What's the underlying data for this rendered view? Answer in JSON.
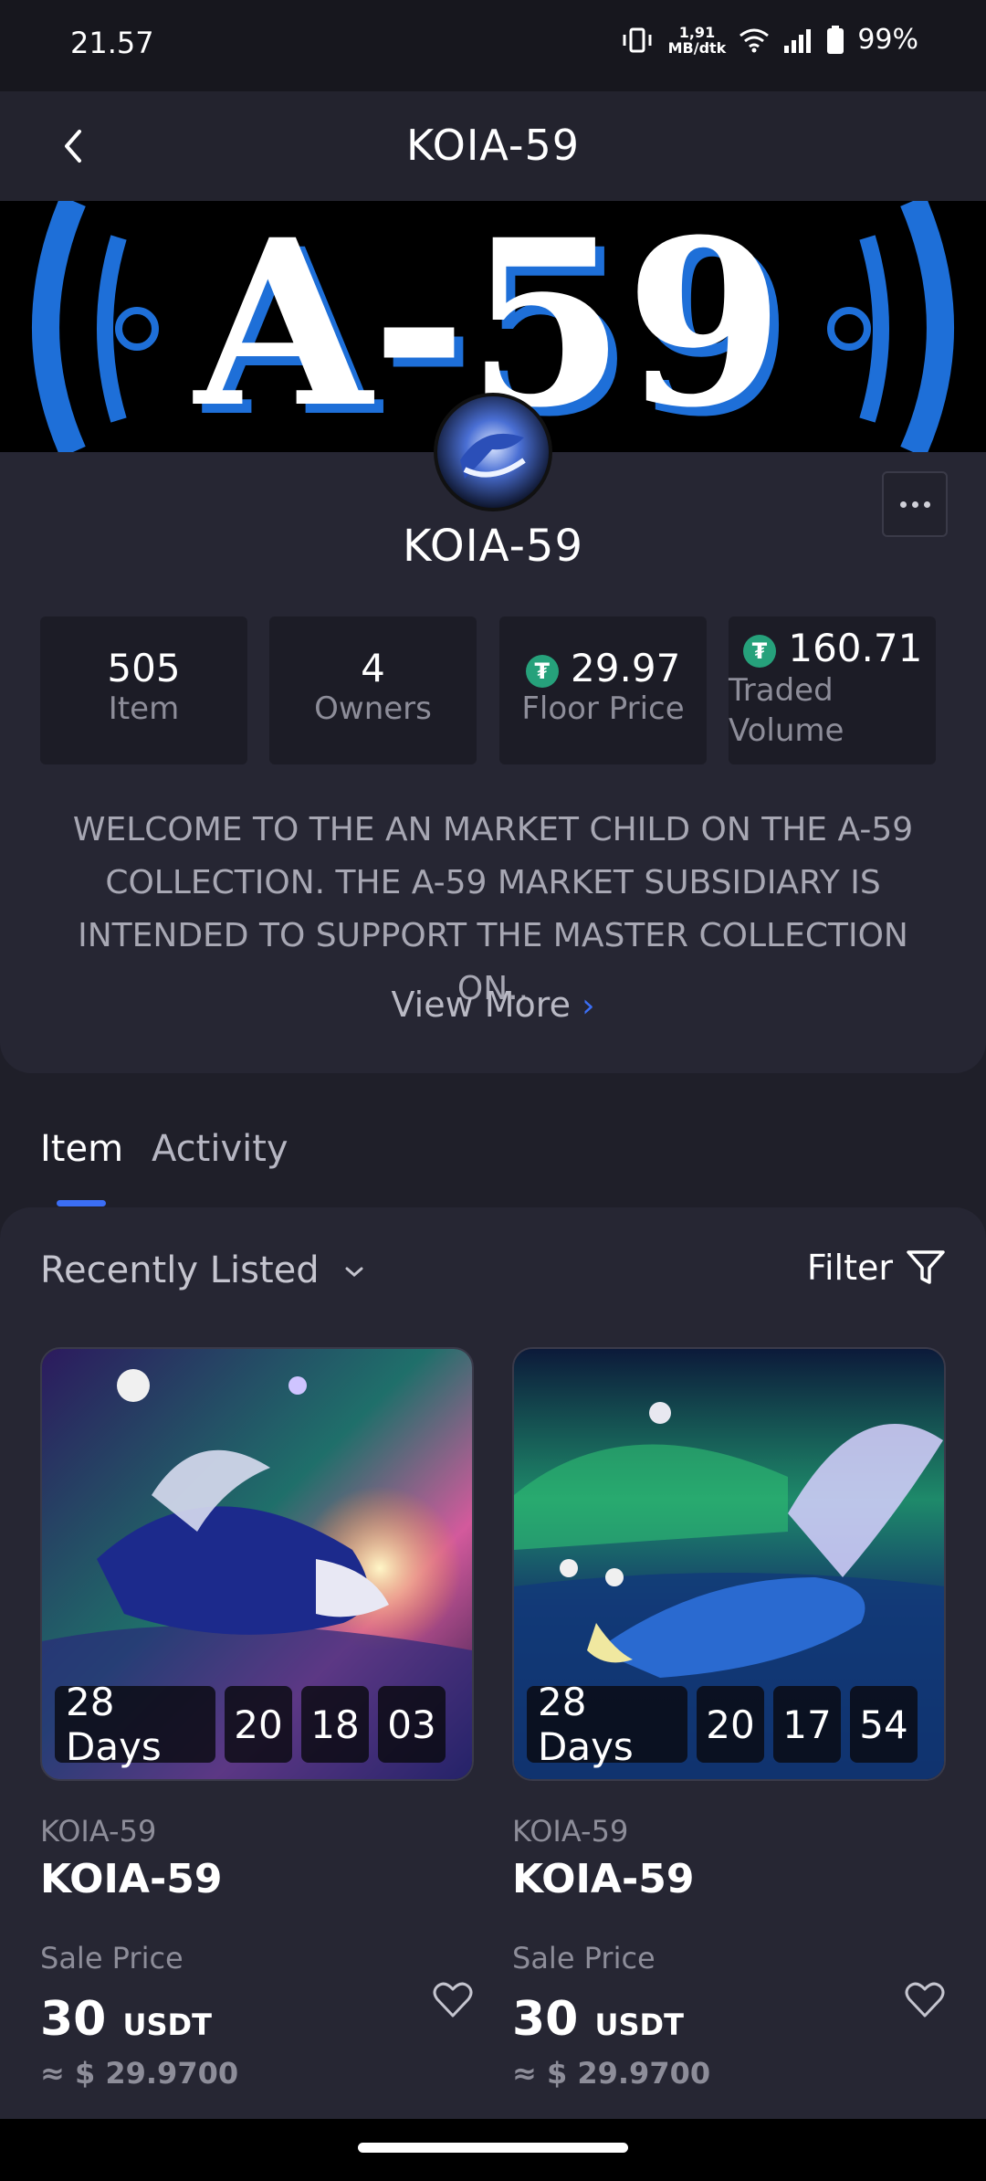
{
  "status_bar": {
    "time": "21.57",
    "speed_value": "1,91",
    "speed_unit": "MB/dtk",
    "battery": "99%"
  },
  "header": {
    "title": "KOIA-59"
  },
  "banner": {
    "text": "A-59"
  },
  "collection": {
    "name": "KOIA-59",
    "stats": [
      {
        "value": "505",
        "label": "Item"
      },
      {
        "value": "4",
        "label": "Owners"
      },
      {
        "value": "29.97",
        "label": "Floor Price",
        "icon": "usdt-icon"
      },
      {
        "value": "160.71",
        "label": "Traded Volume",
        "icon": "usdt-icon"
      }
    ],
    "description_lines": [
      "WELCOME TO THE AN MARKET CHILD ON THE A-59",
      "COLLECTION. THE A-59 MARKET SUBSIDIARY IS",
      "INTENDED TO SUPPORT THE MASTER COLLECTION ON.."
    ],
    "view_more": "View More"
  },
  "tabs": [
    {
      "label": "Item",
      "active": true
    },
    {
      "label": "Activity",
      "active": false
    }
  ],
  "items_panel": {
    "sort_label": "Recently Listed",
    "filter_label": "Filter",
    "cards": [
      {
        "timer": {
          "days": "28 Days",
          "hours": "20",
          "minutes": "18",
          "seconds": "03"
        },
        "collection": "KOIA-59",
        "name": "KOIA-59",
        "sale_label": "Sale Price",
        "price": "30",
        "unit": "USDT",
        "usd": "≈ $ 29.9700"
      },
      {
        "timer": {
          "days": "28 Days",
          "hours": "20",
          "minutes": "17",
          "seconds": "54"
        },
        "collection": "KOIA-59",
        "name": "KOIA-59",
        "sale_label": "Sale Price",
        "price": "30",
        "unit": "USDT",
        "usd": "≈ $ 29.9700"
      }
    ]
  },
  "colors": {
    "accent": "#3b6ef5",
    "background": "#1f1f29",
    "card": "#262633",
    "usdt": "#26a17b"
  }
}
